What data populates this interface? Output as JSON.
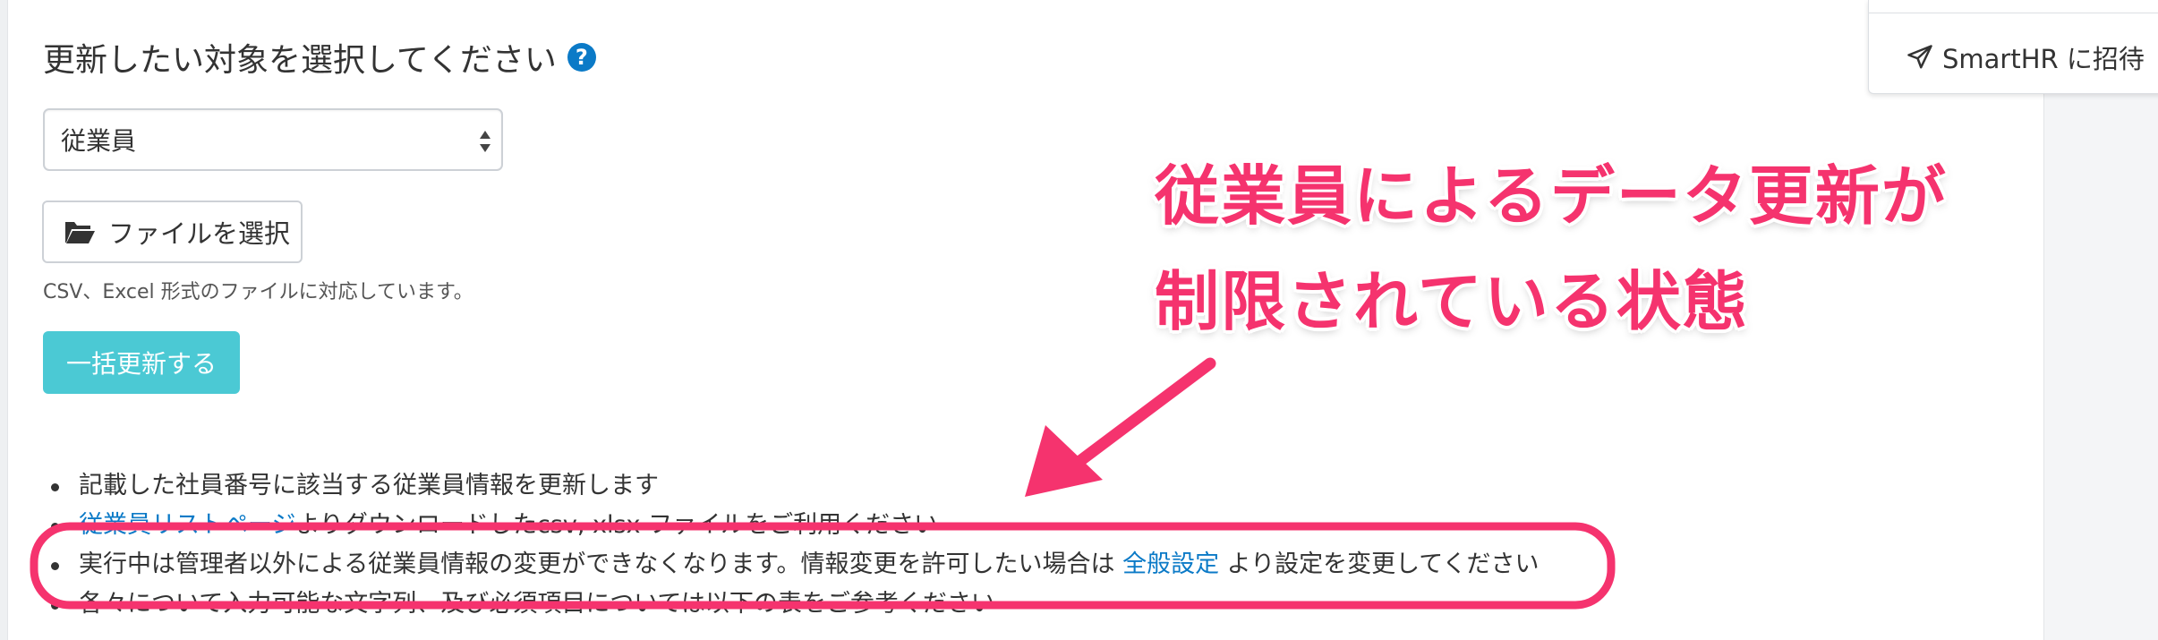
{
  "header": {
    "section_title": "更新したい対象を選択してください",
    "help_icon_glyph": "?"
  },
  "user_menu": {
    "invite_label": "SmartHR に招待",
    "invite_icon": "paper-plane-icon"
  },
  "target_select": {
    "selected_value": "従業員"
  },
  "file_select": {
    "label": "ファイルを選択",
    "icon": "folder-open-icon",
    "help_text": "CSV、Excel 形式のファイルに対応しています。"
  },
  "submit": {
    "label": "一括更新する"
  },
  "notes": {
    "item1": "記載した社員番号に該当する従業員情報を更新します",
    "item2_link": "従業員リストページ",
    "item2_text": "よりダウンロードしたcsv, xlsx ファイルをご利用ください",
    "item3_before": "実行中は管理者以外による従業員情報の変更ができなくなります。情報変更を許可したい場合は ",
    "item3_link": "全般設定",
    "item3_after": " より設定を変更してください",
    "item4": "各々について入力可能な文字列、及び必須項目については以下の表をご参考ください"
  },
  "annotation": {
    "line1": "従業員によるデータ更新が",
    "line2": "制限されている状態",
    "color": "#f5336e"
  },
  "colors": {
    "link": "#0b7ac7",
    "primary_button": "#4bc9d4",
    "help_icon": "#0b7ac7",
    "highlight": "#f5336e"
  }
}
